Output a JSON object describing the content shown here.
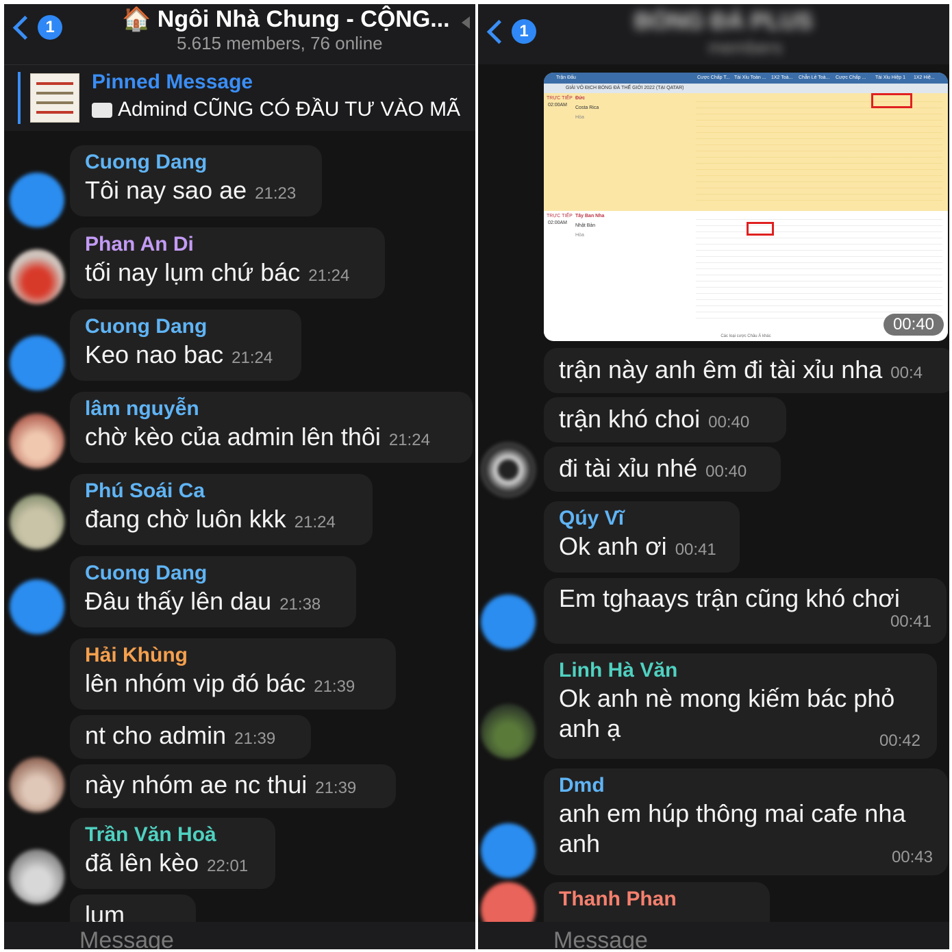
{
  "left": {
    "back_badge": "1",
    "title": "🏠 Ngôi Nhà Chung - CỘNG...",
    "subtitle": "5.615 members, 76 online",
    "pinned_title": "Pinned Message",
    "pinned_text": "Admind CŨNG CÓ ĐẦU TƯ VÀO MÃ",
    "messages": [
      {
        "sender": "Cuong Dang",
        "text": "Tôi nay sao ae",
        "time": "21:23"
      },
      {
        "sender": "Phan An Di",
        "text": "tối nay lụm chứ bác",
        "time": "21:24"
      },
      {
        "sender": "Cuong Dang",
        "text": "Keo nao bac",
        "time": "21:24"
      },
      {
        "sender": "lâm nguyễn",
        "text": "chờ kèo của admin lên thôi",
        "time": "21:24"
      },
      {
        "sender": "Phú Soái Ca",
        "text": "đang chờ luôn kkk",
        "time": "21:24"
      },
      {
        "sender": "Cuong Dang",
        "text": "Đâu thấy lên dau",
        "time": "21:38"
      },
      {
        "sender": "Hải Khùng",
        "text": "lên nhóm vip đó bác",
        "time": "21:39"
      },
      {
        "sender": "",
        "text": "nt cho admin",
        "time": "21:39"
      },
      {
        "sender": "",
        "text": "này nhóm ae nc thui",
        "time": "21:39"
      },
      {
        "sender": "Trần Văn Hoà",
        "text": "đã lên kèo",
        "time": "22:01"
      },
      {
        "sender": "",
        "text": "lum",
        "time": ""
      }
    ],
    "input_placeholder": "Message"
  },
  "right": {
    "back_badge": "1",
    "title": "BÓNG ĐÁ PLUS",
    "subtitle": "members",
    "screenshot": {
      "header_cols": [
        "Trận Đấu",
        "Cược Chấp T...",
        "Tài Xỉu Toàn ...",
        "1X2 Toà...",
        "Chẵn Lẻ Toà...",
        "Cược Chấp ...",
        "Tài Xỉu Hiệp 1",
        "1X2 Hiệ..."
      ],
      "league": "GIẢI VÔ ĐỊCH BÓNG ĐÁ THẾ GIỚI 2022 (TẠI QATAR)",
      "match1": {
        "status": "TRỰC TIẾP",
        "clock": "02:00AM",
        "home": "Đức",
        "away": "Costa Rica",
        "draw": "Hòa"
      },
      "match2": {
        "status": "TRỰC TIẾP",
        "clock": "02:00AM",
        "home": "Tây Ban Nha",
        "away": "Nhật Bản",
        "draw": "Hòa"
      },
      "footer": "Các loại cược Châu Á khác",
      "time": "00:40"
    },
    "messages": [
      {
        "sender": "",
        "text": "trận này anh êm đi tài xỉu nha",
        "time": "00:4"
      },
      {
        "sender": "",
        "text": "trận khó choi",
        "time": "00:40"
      },
      {
        "sender": "",
        "text": "đi tài xỉu nhé",
        "time": "00:40"
      },
      {
        "sender": "Qúy Vĩ",
        "text": "Ok anh ơi",
        "time": "00:41"
      },
      {
        "sender": "",
        "text": "Em tghaays trận cũng khó chơi",
        "time": "00:41"
      },
      {
        "sender": "Linh Hà Văn",
        "text": "Ok anh nè mong kiếm bác phỏ anh ạ",
        "time": "00:42"
      },
      {
        "sender": "Dmd",
        "text": "anh em húp thông mai cafe nha anh",
        "time": "00:43"
      },
      {
        "sender": "Thanh Phan",
        "text": "",
        "time": ""
      }
    ],
    "input_placeholder": "Message"
  },
  "colors": {
    "accent": "#3a8ef6",
    "cuong_dang": "#5fb4f5",
    "phan_an_di": "#c39bf5",
    "lam_nguyen": "#5fb4f5",
    "phu_soai_ca": "#5fb4f5",
    "hai_khung": "#f5a04e",
    "tran_van_hoa": "#4fd1c1",
    "quy_vi": "#5fb4f5",
    "linh_ha_van": "#4fd1c1",
    "dmd": "#5fb4f5",
    "thanh_phan": "#f5806e"
  }
}
